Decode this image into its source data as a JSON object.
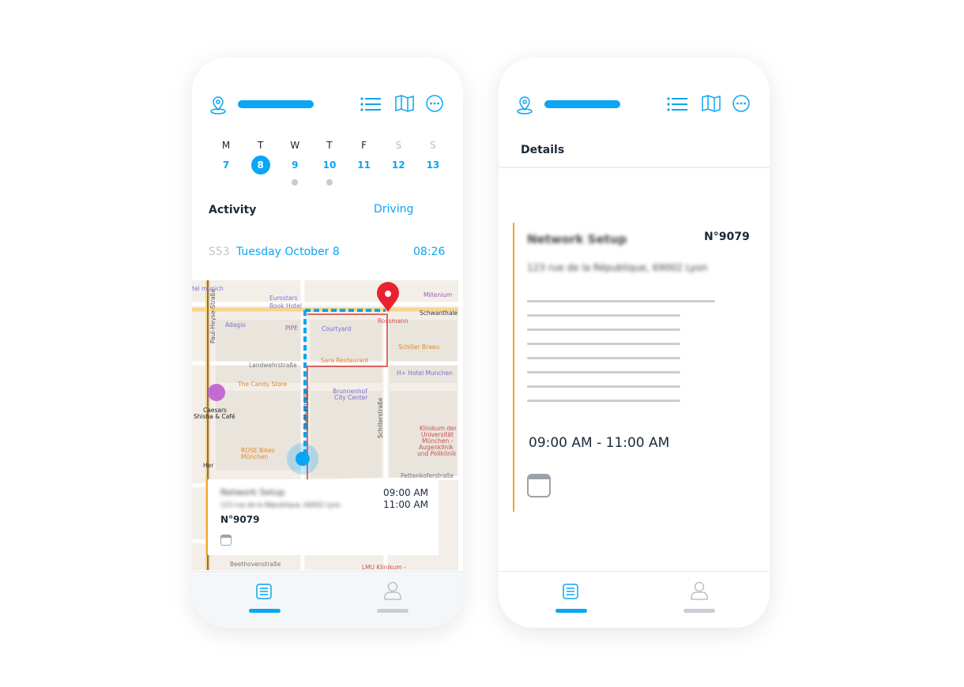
{
  "colors": {
    "accent": "#0aa5f5",
    "event_border": "#f5a623",
    "pin": "#e8232f"
  },
  "header": {
    "icons": [
      "location-pin-icon",
      "list-icon",
      "map-icon",
      "more-icon"
    ]
  },
  "calendar": {
    "days": [
      {
        "letter": "M",
        "num": "7",
        "weekend": false,
        "selected": false,
        "dot": false
      },
      {
        "letter": "T",
        "num": "8",
        "weekend": false,
        "selected": true,
        "dot": false
      },
      {
        "letter": "W",
        "num": "9",
        "weekend": false,
        "selected": false,
        "dot": true
      },
      {
        "letter": "T",
        "num": "10",
        "weekend": false,
        "selected": false,
        "dot": true
      },
      {
        "letter": "F",
        "num": "11",
        "weekend": false,
        "selected": false,
        "dot": false
      },
      {
        "letter": "S",
        "num": "12",
        "weekend": true,
        "selected": false,
        "dot": false
      },
      {
        "letter": "S",
        "num": "13",
        "weekend": true,
        "selected": false,
        "dot": false
      }
    ]
  },
  "activity": {
    "label": "Activity",
    "status": "Driving",
    "week": "S53",
    "date": "Tuesday October 8",
    "time": "08:26"
  },
  "map": {
    "labels": [
      "tel munich",
      "Eurostars",
      "Book Hotel",
      "Millenium",
      "Schwanthale",
      "Adagio",
      "PIPE",
      "Courtyard",
      "Rossmann",
      "Schiller Braeu",
      "Landwehrstraße",
      "Sara Restaurant",
      "H+ Hotel Munchen",
      "The Candy Store",
      "Brunnenhof",
      "City Center",
      "Caesars",
      "Shisha & Café",
      "Klinikum der",
      "Universität",
      "München -",
      "Augenklinik",
      "und Poliklinik",
      "ROSE Bikes",
      "München",
      "Pettenkoferstraße",
      "Beethovenstraße",
      "LMU Klinikum -",
      "Paul-Heyse-Straße",
      "Goethestraße",
      "Schillerstraße",
      "Her"
    ]
  },
  "event": {
    "title": "Network Setup",
    "address": "123 rue de la République, 69002 Lyon",
    "number": "N°9079",
    "start": "09:00 AM",
    "end": "11:00 AM",
    "range": "09:00 AM - 11:00 AM"
  },
  "details": {
    "title": "Details"
  },
  "nav": {
    "items": [
      "list-icon",
      "user-icon"
    ]
  }
}
